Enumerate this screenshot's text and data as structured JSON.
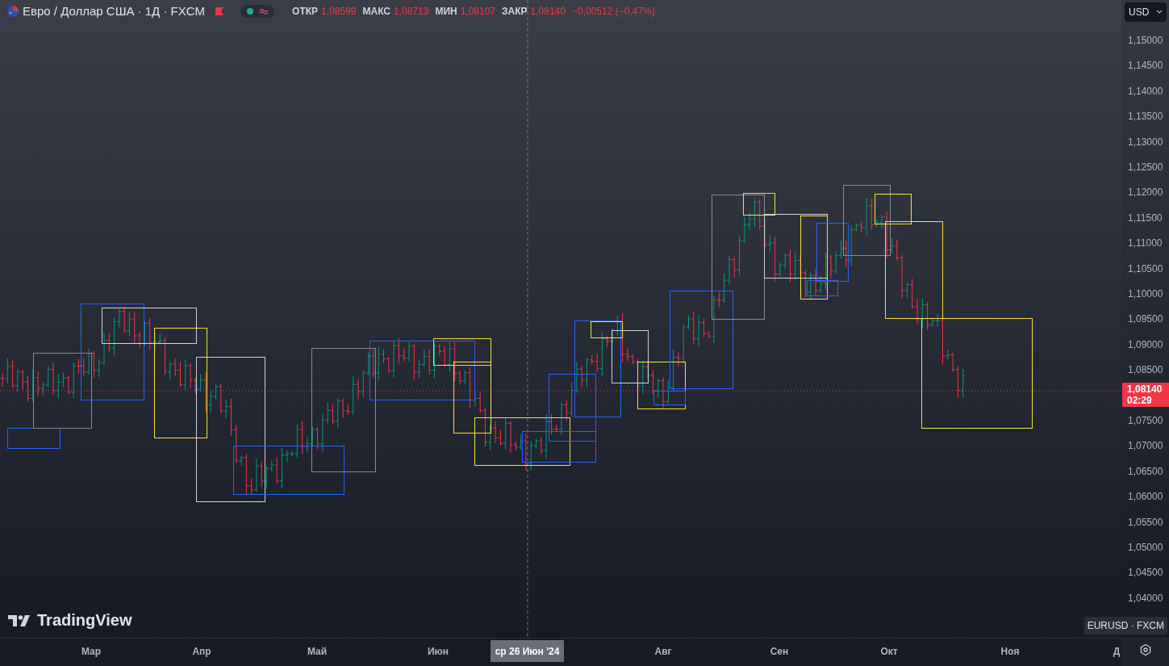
{
  "legend": {
    "title": "Евро / Доллар США · 1Д · FXCM",
    "ohlc": [
      {
        "label": "ОТКР",
        "value": "1,08599"
      },
      {
        "label": "МАКС",
        "value": "1,08713"
      },
      {
        "label": "МИН",
        "value": "1,08107"
      },
      {
        "label": "ЗАКР",
        "value": "1,08140"
      }
    ],
    "change": "−0,00512 (−0,47%)"
  },
  "currency_selector": {
    "value": "USD"
  },
  "price_axis": {
    "ticks": [
      "1,15000",
      "1,14500",
      "1,14000",
      "1,13500",
      "1,13000",
      "1,12500",
      "1,12000",
      "1,11500",
      "1,11000",
      "1,10500",
      "1,10000",
      "1,09500",
      "1,09000",
      "1,08500",
      "1,07500",
      "1,07000",
      "1,06500",
      "1,06000",
      "1,05500",
      "1,05000",
      "1,04500",
      "1,04000"
    ]
  },
  "price_tag": {
    "price": "1,08140",
    "countdown": "02:29"
  },
  "time_axis": {
    "labels": [
      "Мар",
      "Апр",
      "Май",
      "Июн",
      "Авг",
      "Сен",
      "Окт",
      "Ноя",
      "Д"
    ],
    "crosshair_label": "ср 26 Июн '24"
  },
  "symbol_tooltip": "EURUSD · FXCM",
  "logo": "TradingView"
}
